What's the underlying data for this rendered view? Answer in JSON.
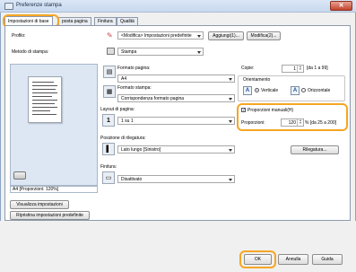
{
  "window": {
    "title": "Preferenze stampa",
    "close_glyph": "✕"
  },
  "tabs": [
    {
      "label": "Impostazioni di base"
    },
    {
      "label": "posta pagina"
    },
    {
      "label": "Finitura"
    },
    {
      "label": "Qualità"
    }
  ],
  "profile": {
    "label": "Profilo:",
    "value": "<Modifica> Impostazioni predefinite",
    "add_button": "Aggiungi(1)...",
    "edit_button": "Modifica(2)..."
  },
  "output_method": {
    "label": "Metodo di stampa:",
    "value": "Stampa"
  },
  "paper_size": {
    "label": "Formato pagina:",
    "value": "A4"
  },
  "output_size": {
    "label": "Formato stampa:",
    "value": "Corrispondenza formato pagina"
  },
  "page_layout": {
    "label": "Layout di pagina:",
    "value": "1 su 1",
    "icon_text": "1"
  },
  "binding": {
    "label": "Posizione di rilegatura:",
    "value": "Lato lungo [Sinistro]"
  },
  "finishing": {
    "label": "Finitura:",
    "value": "Disattivato"
  },
  "copies": {
    "label": "Copie:",
    "value": "1",
    "range": "[da 1 a 99]"
  },
  "orientation": {
    "label": "Orientamento",
    "portrait": "Verticale",
    "landscape": "Orizzontale",
    "selected": "Verticale"
  },
  "manual_scaling": {
    "checkbox_label": "Proporzioni manuali(H)",
    "checked": true,
    "label": "Proporzioni:",
    "value": "120",
    "range": "% [da 25 a 200]"
  },
  "binding_button": "Rilegatura...",
  "preview": {
    "status": "A4 [Proporzioni: 120%]"
  },
  "left_buttons": {
    "view_settings": "Visualizza impostazioni",
    "restore_defaults": "Ripristina impostazioni predefinite"
  },
  "footer": {
    "ok": "OK",
    "cancel": "Annulla",
    "help": "Guida"
  },
  "colors": {
    "highlight": "#f5a623",
    "accent": "#1a4fa3"
  }
}
